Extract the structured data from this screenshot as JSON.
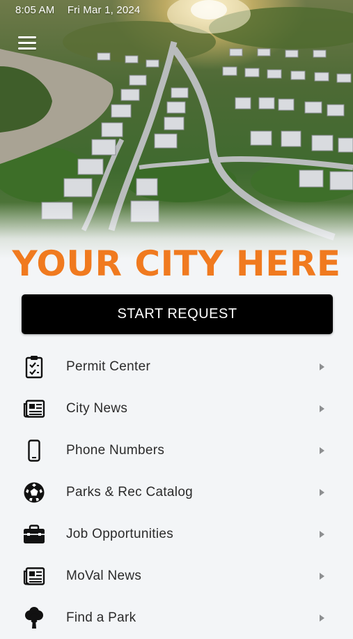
{
  "status_bar": {
    "time": "8:05 AM",
    "date": "Fri Mar 1, 2024"
  },
  "hero": {
    "title": "YOUR CITY HERE",
    "title_color": "#f07a1f"
  },
  "start_request": {
    "label": "START REQUEST"
  },
  "menu": [
    {
      "label": "Permit Center",
      "icon": "clipboard-check-icon"
    },
    {
      "label": "City News",
      "icon": "newspaper-icon"
    },
    {
      "label": "Phone Numbers",
      "icon": "smartphone-icon"
    },
    {
      "label": "Parks & Rec Catalog",
      "icon": "soccer-ball-icon"
    },
    {
      "label": "Job Opportunities",
      "icon": "briefcase-icon"
    },
    {
      "label": "MoVal News",
      "icon": "newspaper-icon"
    },
    {
      "label": "Find a Park",
      "icon": "tree-icon"
    }
  ],
  "colors": {
    "background": "#f3f5f7",
    "button": "#000000",
    "accent": "#f07a1f",
    "chevron": "#8d8f91"
  }
}
